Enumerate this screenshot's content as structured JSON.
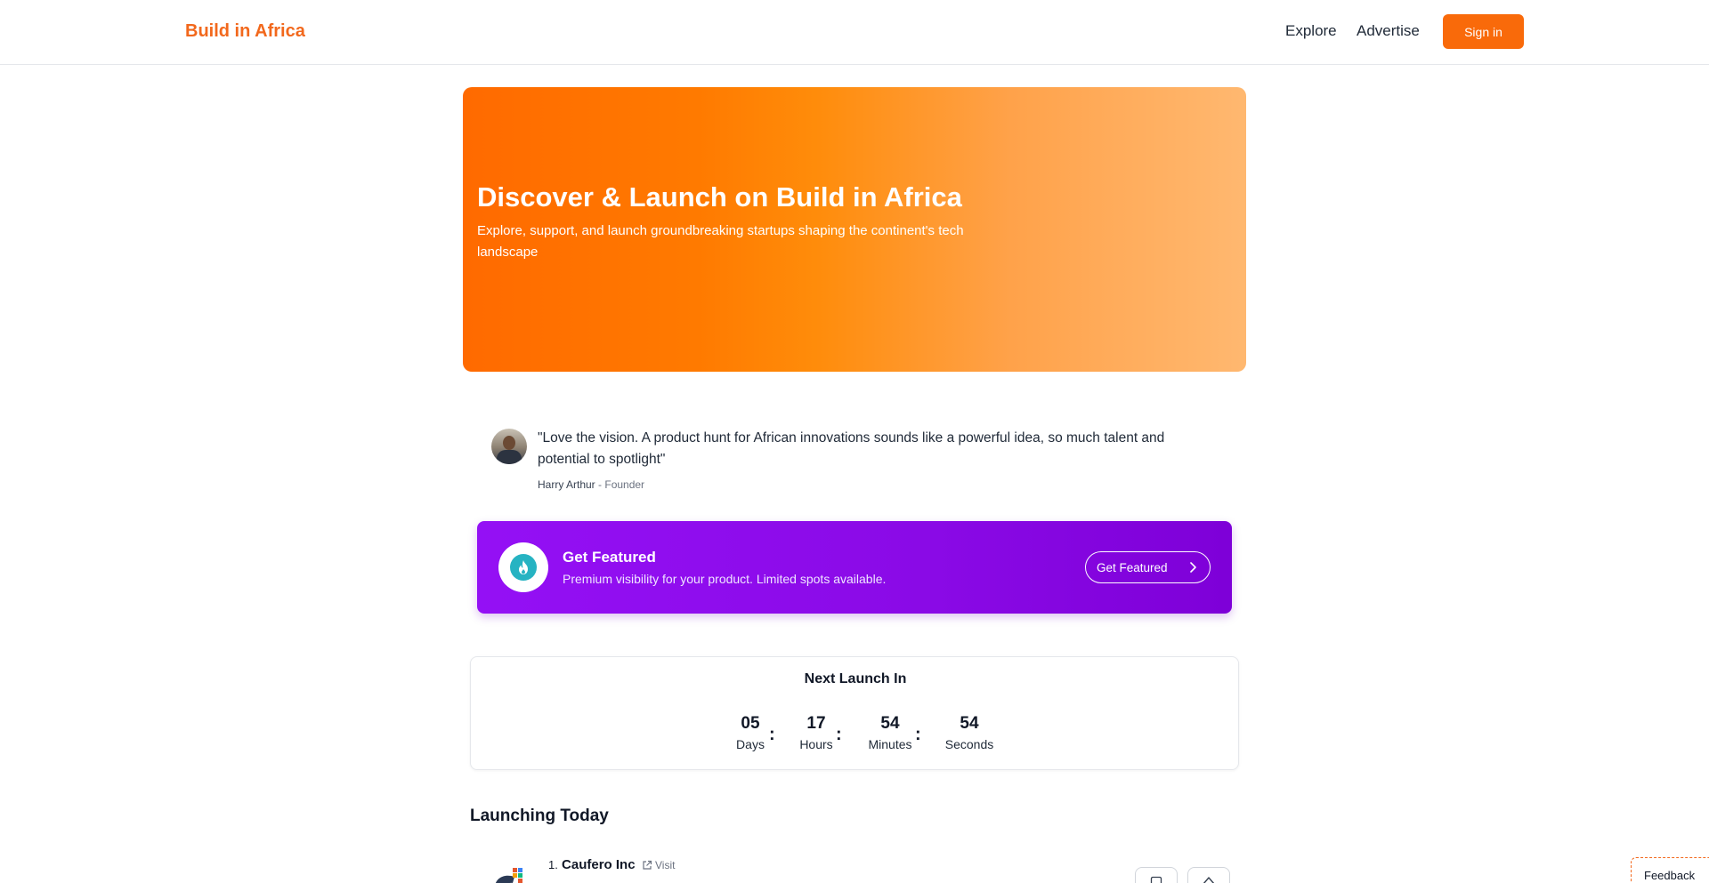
{
  "header": {
    "logo": "Build in Africa",
    "nav": {
      "explore": "Explore",
      "advertise": "Advertise"
    },
    "signin_label": "Sign in",
    "accent_color": "#f96a0a"
  },
  "hero": {
    "title": "Discover & Launch on Build in Africa",
    "subtitle": "Explore, support, and launch groundbreaking startups shaping the continent's tech landscape"
  },
  "testimonial": {
    "quote": "\"Love the vision. A product hunt for African innovations sounds like a powerful idea, so much talent and potential to spotlight\"",
    "author": "Harry Arthur",
    "separator": " - ",
    "role": "Founder"
  },
  "featured": {
    "icon": "flame-icon",
    "title": "Get Featured",
    "subtitle": "Premium visibility for your product. Limited spots available.",
    "button_label": "Get Featured",
    "color": "#8a0ae6"
  },
  "countdown": {
    "title": "Next Launch In",
    "units": [
      {
        "value": "05",
        "label": "Days"
      },
      {
        "value": "17",
        "label": "Hours"
      },
      {
        "value": "54",
        "label": "Minutes"
      },
      {
        "value": "54",
        "label": "Seconds"
      }
    ],
    "separator": ":"
  },
  "launching_today": {
    "title": "Launching Today",
    "products": [
      {
        "rank": "1.",
        "name": "Caufero Inc",
        "visit_label": "Visit"
      }
    ]
  },
  "feedback_label": "Feedback"
}
